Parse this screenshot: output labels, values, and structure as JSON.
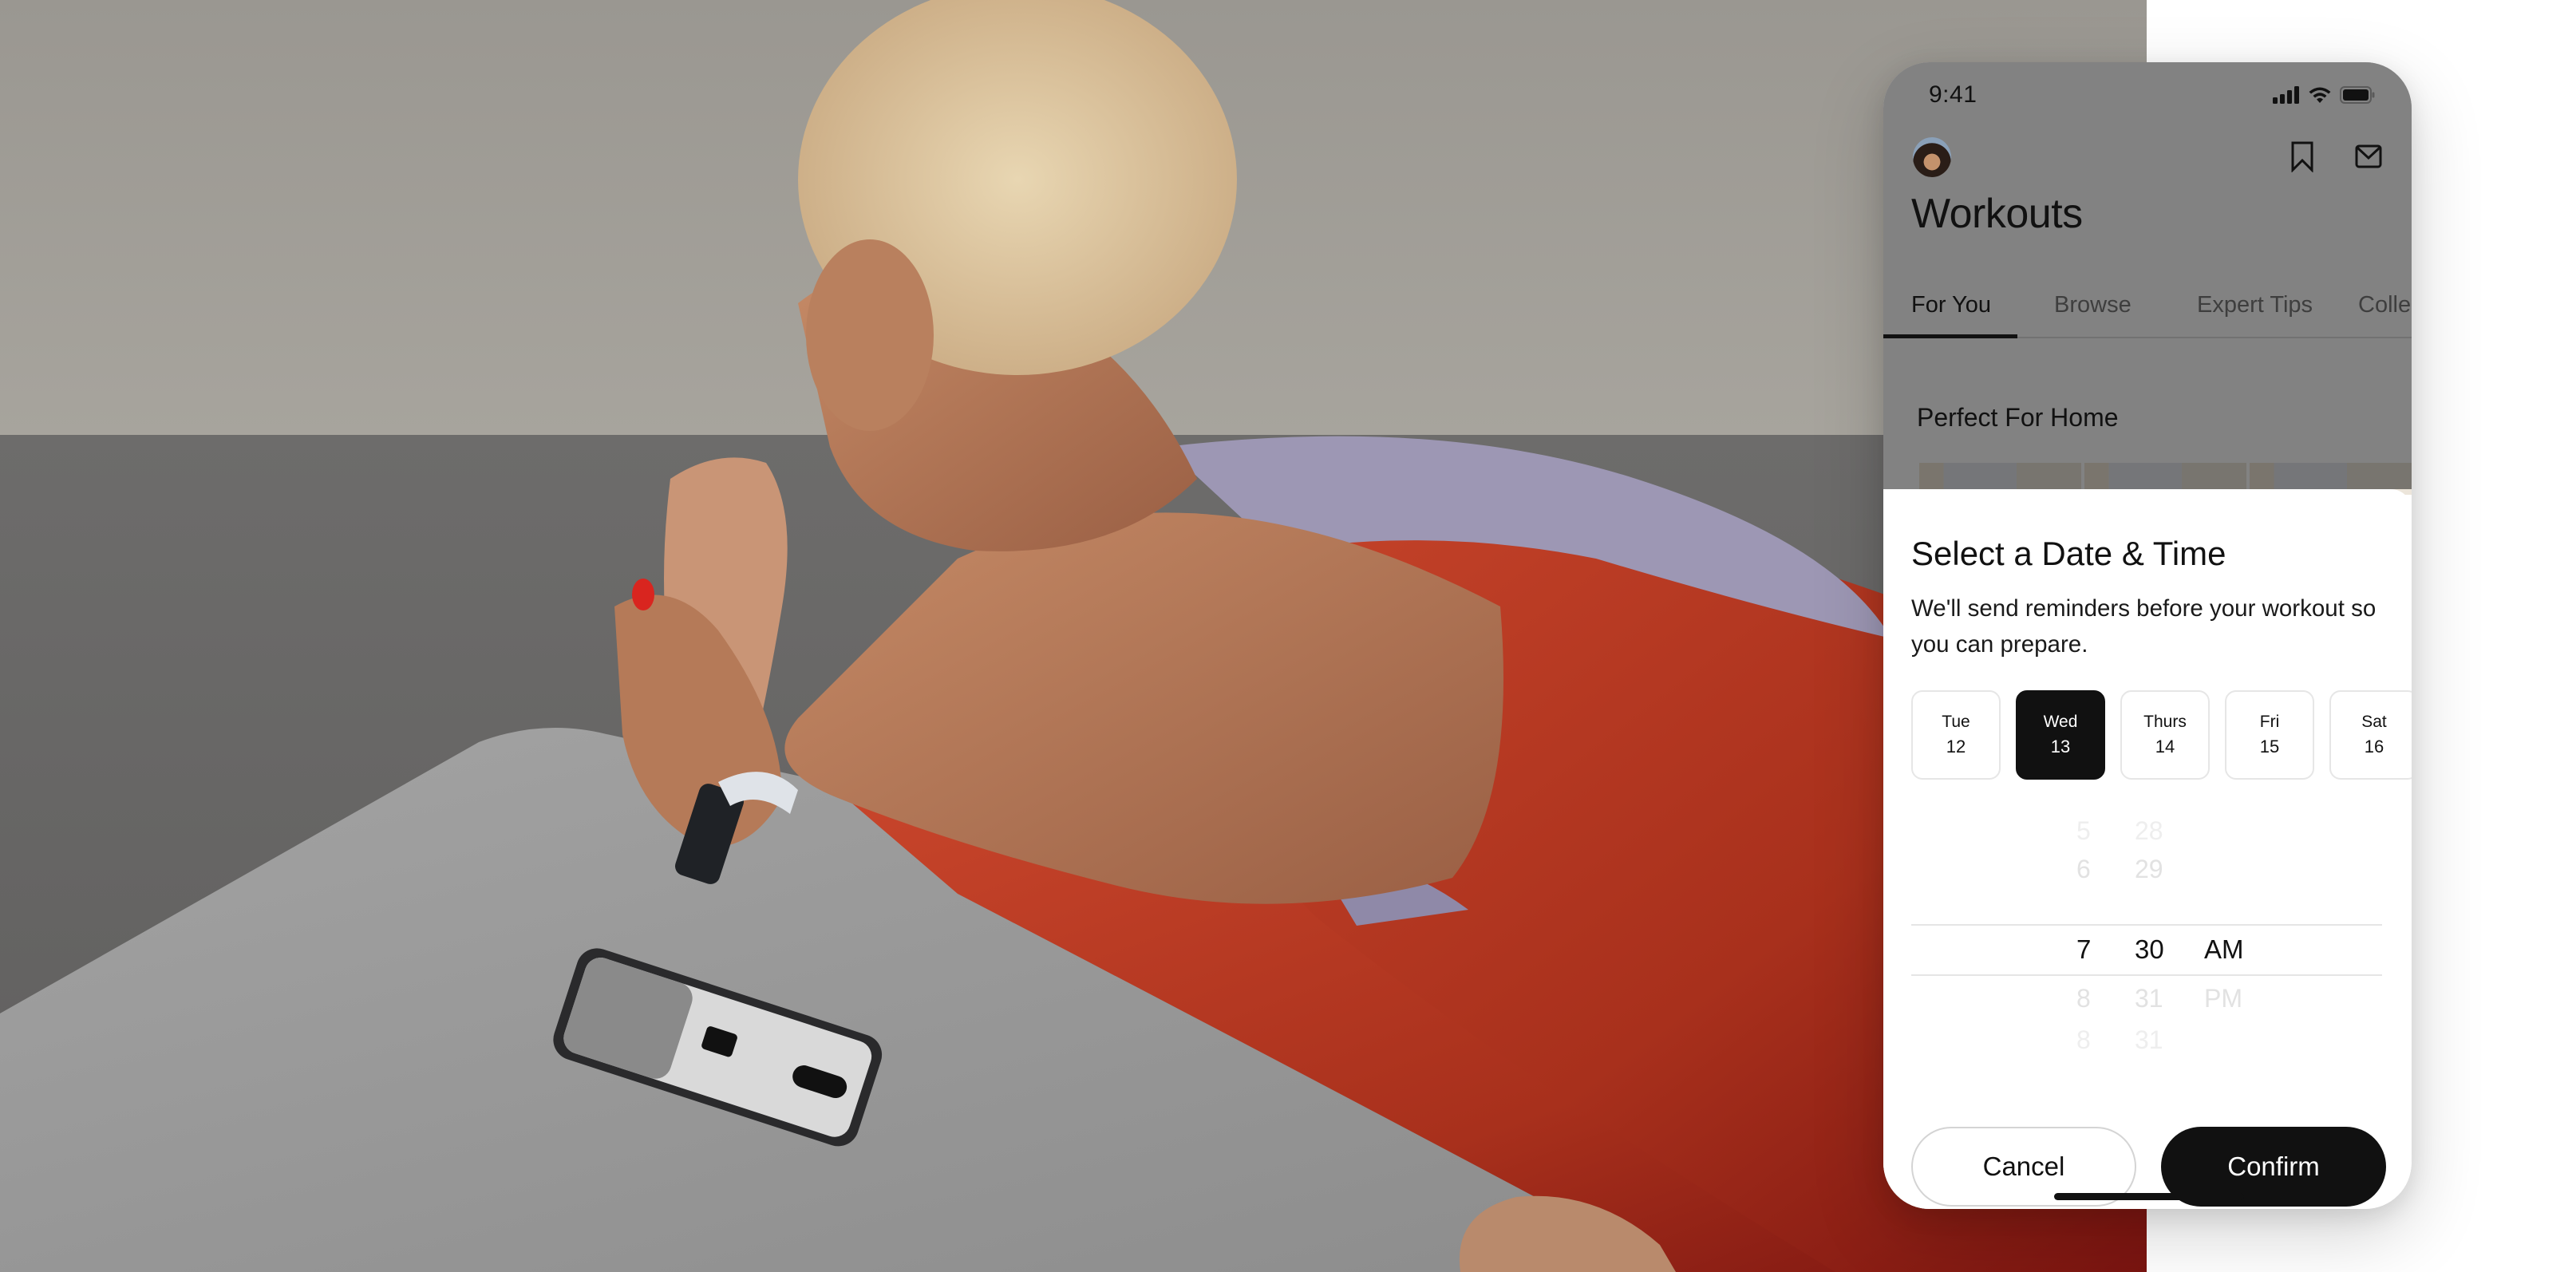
{
  "status_bar": {
    "time": "9:41",
    "icons": [
      "cellular-signal-icon",
      "wifi-icon",
      "battery-icon"
    ]
  },
  "header": {
    "avatar_icon": "user-avatar",
    "actions": [
      {
        "name": "bookmark-icon",
        "label": "Saved"
      },
      {
        "name": "mail-icon",
        "label": "Inbox"
      }
    ]
  },
  "page": {
    "title": "Workouts"
  },
  "tabs": [
    {
      "label": "For You",
      "active": true
    },
    {
      "label": "Browse",
      "active": false
    },
    {
      "label": "Expert Tips",
      "active": false
    },
    {
      "label": "Colle",
      "active": false
    }
  ],
  "section": {
    "title": "Perfect For Home"
  },
  "sheet": {
    "title": "Select a Date & Time",
    "description": "We'll send reminders before your workout so you can prepare.",
    "dates": [
      {
        "day": "Tue",
        "date": "12",
        "selected": false
      },
      {
        "day": "Wed",
        "date": "13",
        "selected": true
      },
      {
        "day": "Thurs",
        "date": "14",
        "selected": false
      },
      {
        "day": "Fri",
        "date": "15",
        "selected": false
      },
      {
        "day": "Sat",
        "date": "16",
        "selected": false
      }
    ],
    "time_picker": {
      "hours": [
        "5",
        "6",
        "7",
        "8",
        "8"
      ],
      "minutes": [
        "28",
        "29",
        "30",
        "31",
        "31"
      ],
      "periods": [
        "",
        "",
        "AM",
        "PM",
        ""
      ],
      "selected": {
        "hour": "7",
        "minute": "30",
        "period": "AM"
      }
    },
    "cancel_label": "Cancel",
    "confirm_label": "Confirm"
  },
  "colors": {
    "primary": "#111111",
    "chip_border": "#e6e6e6",
    "faint_text": "#e2e2e2",
    "overlay": "rgba(0,0,0,0.49)"
  }
}
